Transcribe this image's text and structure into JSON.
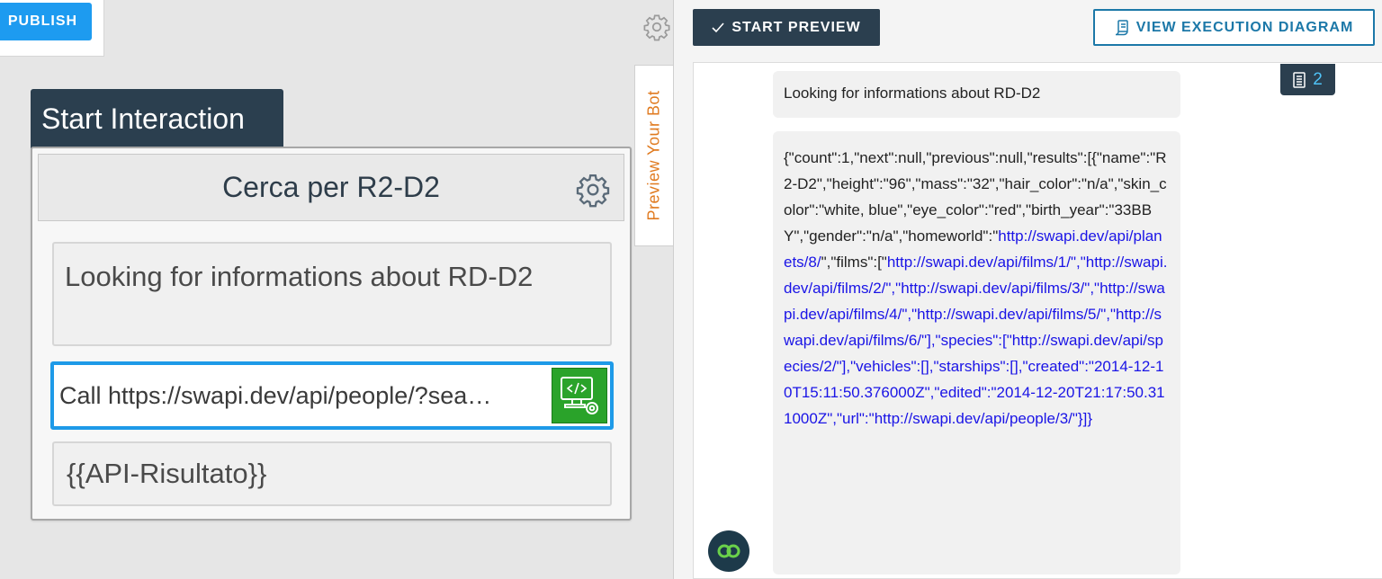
{
  "toolbar": {
    "publish_label": "PUBLISH"
  },
  "flow": {
    "start_tab_label": "Start Interaction",
    "block_title": "Cerca per R2-D2",
    "text_card": "Looking for informations about RD-D2",
    "api_card": "Call https://swapi.dev/api/people/?sea…",
    "result_card": "{{API-Risultato}}"
  },
  "preview_tab": {
    "label": "Preview Your Bot"
  },
  "preview": {
    "start_label": "START PREVIEW",
    "diagram_label": "VIEW EXECUTION DIAGRAM",
    "counter": "2",
    "message_1": "Looking for informations about RD-D2",
    "message_2_parts": [
      "{\"count\":1,\"next\":null,\"previous\":null,\"results\":[{\"name\":\"R2-D2\",\"height\":\"96\",\"mass\":\"32\",\"hair_color\":\"n/a\",\"skin_color\":\"white, blue\",\"eye_color\":\"red\",\"birth_year\":\"33BBY\",\"gender\":\"n/a\",\"homeworld\":\"",
      "http://swapi.dev/api/planets/8/",
      "\",\"films\":[\"",
      "http://swapi.dev/api/films/1/",
      "\",\"",
      "http://swapi.dev/api/films/2/",
      "\",\"",
      "http://swapi.dev/api/films/3/",
      "\",\"",
      "http://swapi.dev/api/films/4/",
      "\",\"",
      "http://swapi.dev/api/films/5/",
      "\",\"",
      "http://swapi.dev/api/films/6/",
      "\"],\"species\":[\"",
      "http://swapi.dev/api/species/2/",
      "\"],\"vehicles\":[],\"starships\":[],\"created\":\"2014-12-10T15:11:50.376000Z\",\"edited\":\"2014-12-20T21:17:50.311000Z\",\"url\":\"",
      "http://swapi.dev/api/people/3/",
      "\"}]}"
    ]
  },
  "colors": {
    "navy": "#2b3f4f",
    "publish_blue": "#1d9bf0",
    "link_blue": "#1a14e6",
    "preview_orange": "#e07a1f",
    "api_green": "#2aa32a"
  }
}
